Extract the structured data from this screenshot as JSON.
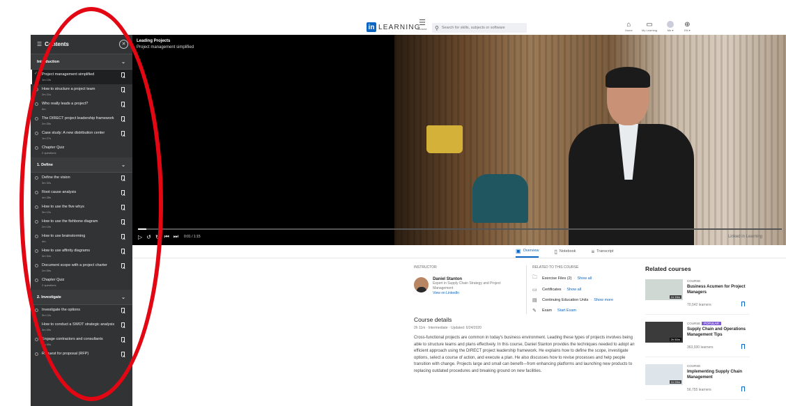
{
  "nav": {
    "brand": "LEARNING",
    "browse": "Browse",
    "search_placeholder": "Search for skills, subjects or software",
    "home": "Home",
    "my_learning": "My Learning",
    "me": "Me ▾",
    "language": "EN ▾"
  },
  "sidebar": {
    "title": "Contents",
    "sections": [
      {
        "name": "Introduction",
        "items": [
          {
            "title": "Project management simplified",
            "duration": "1m 13s",
            "done": true,
            "current": true,
            "bookmark": true
          },
          {
            "title": "How to structure a project team",
            "duration": "2m 21s",
            "bookmark": true
          },
          {
            "title": "Who really leads a project?",
            "duration": "5m",
            "bookmark": true
          },
          {
            "title": "The DIRECT project leadership framework",
            "duration": "2m 55s",
            "bookmark": true
          },
          {
            "title": "Case study: A new distribution center",
            "duration": "1m 27s",
            "bookmark": true
          },
          {
            "title": "Chapter Quiz",
            "duration": "2 questions",
            "bookmark": false
          }
        ]
      },
      {
        "name": "1. Define",
        "items": [
          {
            "title": "Define the vision",
            "duration": "3m 32s",
            "bookmark": true
          },
          {
            "title": "Root cause analysis",
            "duration": "4m 28s",
            "bookmark": true
          },
          {
            "title": "How to use the five whys",
            "duration": "3m 12s",
            "bookmark": true
          },
          {
            "title": "How to use the fishbone diagram",
            "duration": "2m 10s",
            "bookmark": true
          },
          {
            "title": "How to use brainstorming",
            "duration": "4m",
            "bookmark": true
          },
          {
            "title": "How to use affinity diagrams",
            "duration": "3m 54s",
            "bookmark": true
          },
          {
            "title": "Document scope with a project charter",
            "duration": "2m 59s",
            "bookmark": true
          },
          {
            "title": "Chapter Quiz",
            "duration": "2 questions",
            "bookmark": false
          }
        ]
      },
      {
        "name": "2. Investigate",
        "items": [
          {
            "title": "Investigate the options",
            "duration": "3m 12s",
            "bookmark": true
          },
          {
            "title": "How to conduct a SWOT strategic analysis",
            "duration": "3m 59s",
            "bookmark": true
          },
          {
            "title": "Engage contractors and consultants",
            "duration": "2m 50s",
            "bookmark": true
          },
          {
            "title": "Request for proposal (RFP)",
            "duration": "",
            "bookmark": true
          }
        ]
      }
    ]
  },
  "player": {
    "course_title": "Leading Projects",
    "video_title": "Project management simplified",
    "time": "0:01 / 1:15",
    "progress": 0.013,
    "watermark": "Linked in Learning"
  },
  "tabs": [
    {
      "label": "Overview",
      "icon": "overview-icon",
      "active": true
    },
    {
      "label": "Notebook",
      "icon": "notebook-icon",
      "active": false
    },
    {
      "label": "Transcript",
      "icon": "transcript-icon",
      "active": false
    }
  ],
  "instructor": {
    "label": "INSTRUCTOR",
    "name": "Daniel Stanton",
    "role": "Expert in Supply Chain Strategy and Project Management",
    "link": "View on LinkedIn"
  },
  "related_to_course": {
    "label": "RELATED TO THIS COURSE",
    "rows": [
      {
        "icon": "folder-icon",
        "text": "Exercise Files (2)",
        "link": "Show all"
      },
      {
        "icon": "certificate-icon",
        "text": "Certificates",
        "link": "Show all"
      },
      {
        "icon": "ceu-icon",
        "text": "Continuing Education Units",
        "link": "Show more"
      },
      {
        "icon": "exam-icon",
        "text": "Exam",
        "link": "Start Exam"
      }
    ]
  },
  "course_details": {
    "heading": "Course details",
    "meta": "2h 11m · Intermediate · Updated: 6/24/2020",
    "description": "Cross-functional projects are common in today's business environment. Leading these types of projects involves being able to structure teams and plans effectively. In this course, Daniel Stanton provides the techniques needed to adopt an efficient approach using the DIRECT project leadership framework. He explains how to define the scope, investigate options, select a course of action, and execute a plan. He also discusses how to revise processes and help people transition with change. Projects large and small can benefit—from enhancing platforms and launching new products to replacing outdated procedures and breaking ground on new facilities."
  },
  "related_courses": {
    "heading": "Related courses",
    "items": [
      {
        "kind": "COURSE",
        "popular": false,
        "name": "Business Acumen for Project Managers",
        "learners": "70,542 learners",
        "duration": "1h 15m"
      },
      {
        "kind": "COURSE",
        "popular": true,
        "popular_label": "POPULAR",
        "name": "Supply Chain and Operations Management Tips",
        "learners": "363,930 learners",
        "duration": "2h 50m"
      },
      {
        "kind": "COURSE",
        "popular": false,
        "name": "Implementing Supply Chain Management",
        "learners": "56,755 learners",
        "duration": "1h 25m"
      }
    ]
  },
  "colors": {
    "accent": "#0a66c2",
    "sidebar_bg": "#323335",
    "annotation": "#e30613",
    "popular": "#7f5bd5"
  }
}
